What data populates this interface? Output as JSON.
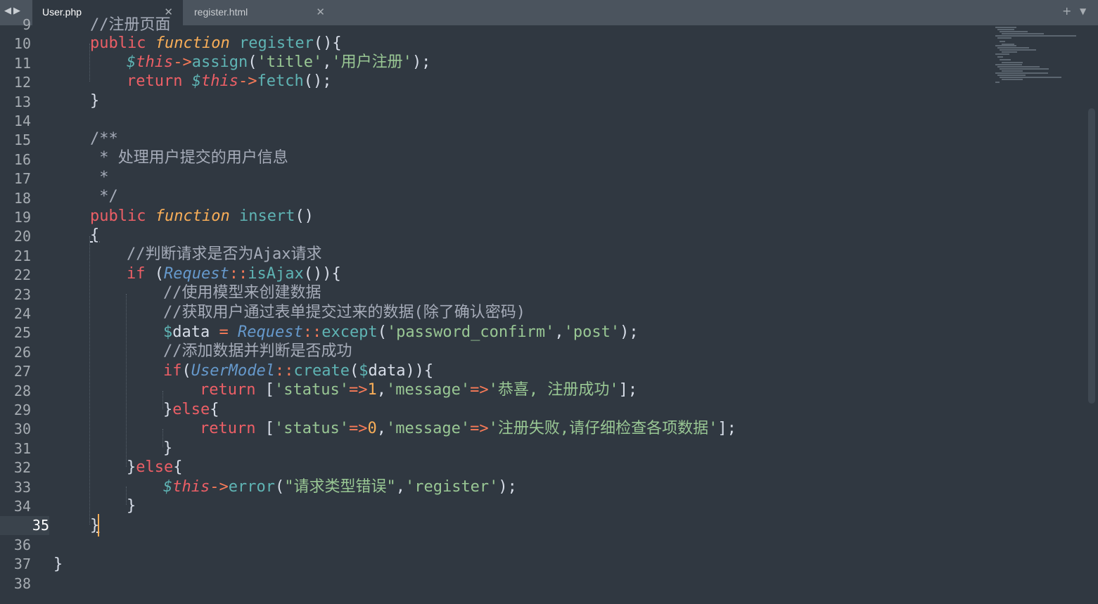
{
  "tabs": [
    {
      "label": "User.php",
      "active": true
    },
    {
      "label": "register.html",
      "active": false
    }
  ],
  "tab_close_glyph": "✕",
  "nav": {
    "back": "◀",
    "forward": "▶"
  },
  "tab_controls": {
    "new_tab": "+",
    "menu": "▼"
  },
  "partial_top_line": "//注册页面",
  "line_numbers": [
    "9",
    "10",
    "11",
    "12",
    "13",
    "14",
    "15",
    "16",
    "17",
    "18",
    "19",
    "20",
    "21",
    "22",
    "23",
    "24",
    "25",
    "26",
    "27",
    "28",
    "29",
    "30",
    "31",
    "32",
    "33",
    "34",
    "35",
    "36",
    "37",
    "38"
  ],
  "current_line": "35",
  "code": {
    "l10": [
      "public",
      "function",
      "register",
      "(){"
    ],
    "l11": [
      "$",
      "this",
      "->",
      "assign",
      "(",
      "'title'",
      ",",
      "'用户注册'",
      ");"
    ],
    "l12": [
      "return",
      "$",
      "this",
      "->",
      "fetch",
      "();"
    ],
    "l13": "}",
    "l15": "/**",
    "l16": " * 处理用户提交的用户信息",
    "l17": " *",
    "l18": " */",
    "l19": [
      "public",
      "function",
      "insert",
      "()"
    ],
    "l20": "{",
    "l21": "//判断请求是否为Ajax请求",
    "l22": [
      "if",
      " (",
      "Request",
      "::",
      "isAjax",
      "()){"
    ],
    "l23": "//使用模型来创建数据",
    "l24": "//获取用户通过表单提交过来的数据(除了确认密码)",
    "l25": [
      "$",
      "data",
      " = ",
      "Request",
      "::",
      "except",
      "(",
      "'password_confirm'",
      ",",
      "'post'",
      ");"
    ],
    "l26": "//添加数据并判断是否成功",
    "l27": [
      "if",
      "(",
      "UserModel",
      "::",
      "create",
      "(",
      "$",
      "data",
      ")){"
    ],
    "l28": [
      "return",
      " [",
      "'status'",
      "=>",
      "1",
      ",",
      "'message'",
      "=>",
      "'恭喜, 注册成功'",
      "];"
    ],
    "l29": [
      "}",
      "else",
      "{"
    ],
    "l30": [
      "return",
      " [",
      "'status'",
      "=>",
      "0",
      ",",
      "'message'",
      "=>",
      "'注册失败,请仔细检查各项数据'",
      "];"
    ],
    "l31": "}",
    "l32": [
      "}",
      "else",
      "{"
    ],
    "l33": [
      "$",
      "this",
      "->",
      "error",
      "(",
      "\"请求类型错误\"",
      ",",
      "'register'",
      ");"
    ],
    "l34": "}",
    "l35": "}",
    "l37": "}"
  },
  "colors": {
    "background": "#303841",
    "tabbar": "#4b545e",
    "keyword": "#ec5f66",
    "function_name": "#5fb4b4",
    "storage": "#f9ae58",
    "class": "#6699cc",
    "string": "#99c794",
    "number": "#f9ae58",
    "operator": "#f97b58",
    "comment": "#a6acb9",
    "caret": "#f9ae58"
  }
}
